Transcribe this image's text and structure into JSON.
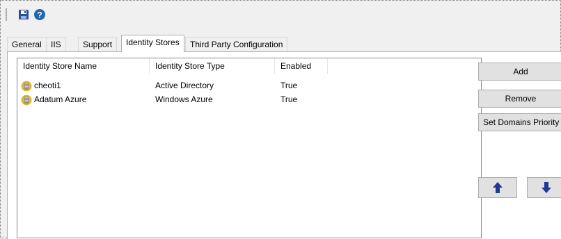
{
  "toolbar": {
    "save_icon": "save-icon",
    "help_icon": "help-icon"
  },
  "tabs": [
    {
      "label": "General"
    },
    {
      "label": "IIS"
    },
    {
      "label": "Support"
    },
    {
      "label": "Identity Stores",
      "active": true
    },
    {
      "label": "Third Party Configuration"
    }
  ],
  "list": {
    "columns": [
      "Identity Store Name",
      "Identity Store Type",
      "Enabled"
    ],
    "rows": [
      {
        "name": "cheoti1",
        "type": "Active Directory",
        "enabled": "True",
        "icon": "identity-store-icon"
      },
      {
        "name": "Adatum Azure",
        "type": "Windows Azure",
        "enabled": "True",
        "icon": "identity-store-icon"
      }
    ]
  },
  "buttons": {
    "add": "Add",
    "remove": "Remove",
    "set_priority": "Set Domains Priority",
    "move_up_icon": "arrow-up-icon",
    "move_down_icon": "arrow-down-icon"
  },
  "colors": {
    "accent_icon_blue": "#1f3a93",
    "store_icon_gold": "#e7b72a"
  }
}
